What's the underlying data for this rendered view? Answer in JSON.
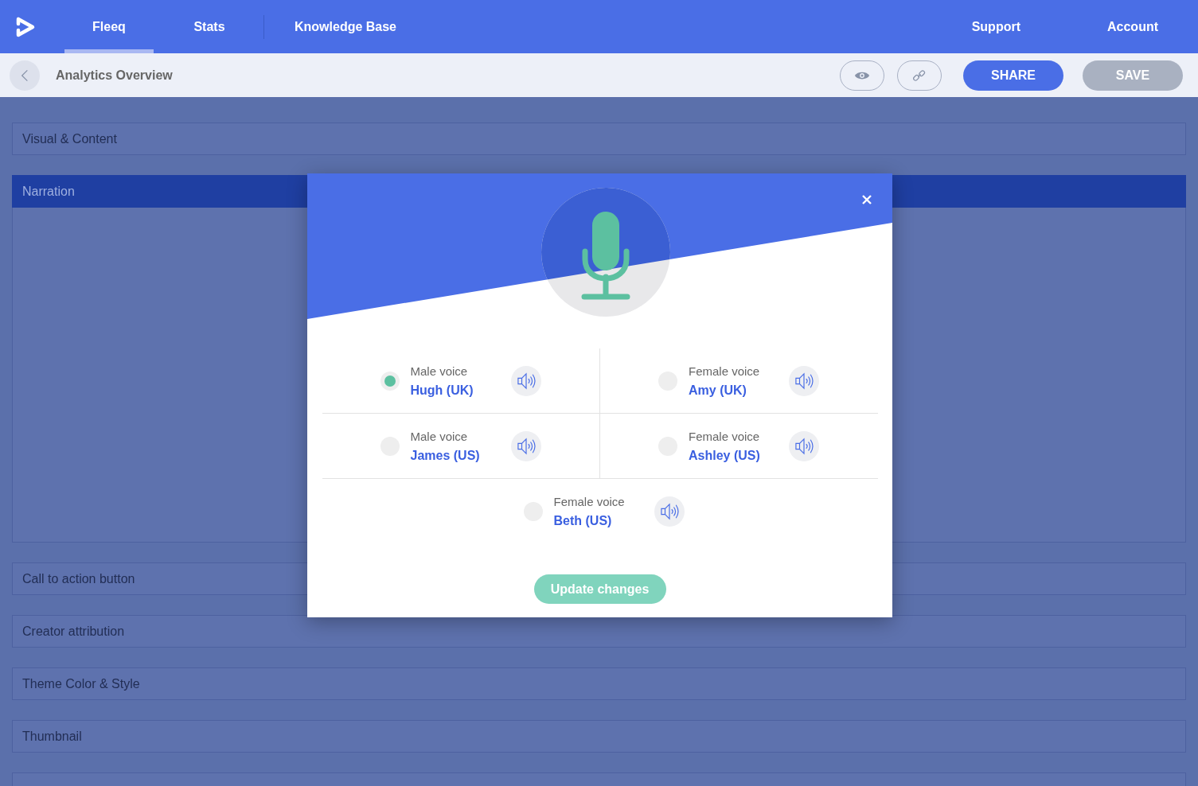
{
  "nav": {
    "tabs": [
      {
        "label": "Fleeq",
        "selected": true
      },
      {
        "label": "Stats",
        "selected": false
      },
      {
        "label": "Knowledge Base",
        "selected": false
      }
    ],
    "right_links": [
      "Support",
      "Account"
    ]
  },
  "toolbar": {
    "title": "Analytics Overview",
    "buttons": [
      {
        "label": "SHARE",
        "disabled": false
      },
      {
        "label": "SAVE",
        "disabled": true
      }
    ]
  },
  "sections": [
    {
      "title": "Visual & Content",
      "expanded": false
    },
    {
      "title": "Narration",
      "expanded": true
    },
    {
      "title": "Call to action button",
      "expanded": false
    },
    {
      "title": "Creator attribution",
      "expanded": false
    },
    {
      "title": "Theme Color & Style",
      "expanded": false
    },
    {
      "title": "Thumbnail",
      "expanded": false
    }
  ],
  "modal": {
    "voices": [
      {
        "type": "Male voice",
        "name": "Hugh (UK)",
        "selected": true
      },
      {
        "type": "Female voice",
        "name": "Amy (UK)",
        "selected": false
      },
      {
        "type": "Male voice",
        "name": "James (US)",
        "selected": false
      },
      {
        "type": "Female voice",
        "name": "Ashley (US)",
        "selected": false
      },
      {
        "type": "Female voice",
        "name": "Beth (US)",
        "selected": false
      }
    ],
    "button": "Update changes"
  }
}
